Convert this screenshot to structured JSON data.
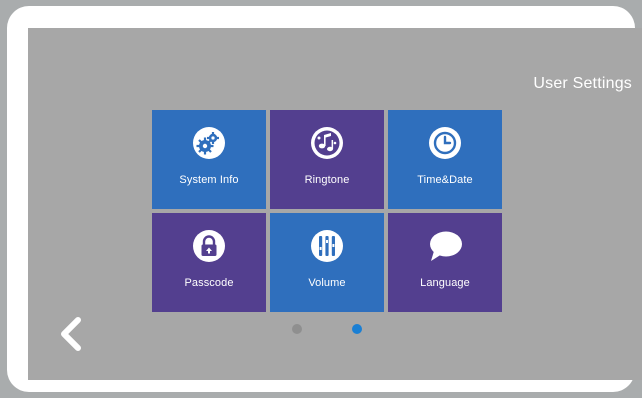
{
  "screen": {
    "title": "User Settings"
  },
  "tiles": [
    {
      "label": "System Info",
      "icon": "gears-icon",
      "color": "#2f6fbd"
    },
    {
      "label": "Ringtone",
      "icon": "music-notes-icon",
      "color": "#533f8f"
    },
    {
      "label": "Time&Date",
      "icon": "clock-icon",
      "color": "#2f6fbd"
    },
    {
      "label": "Passcode",
      "icon": "lock-icon",
      "color": "#533f8f"
    },
    {
      "label": "Volume",
      "icon": "equalizer-icon",
      "color": "#2f6fbd"
    },
    {
      "label": "Language",
      "icon": "speech-bubble-icon",
      "color": "#533f8f"
    }
  ],
  "pagination": {
    "pages": 2,
    "active_page": 2,
    "inactive_color": "#8f8f8f",
    "active_color": "#1a7fd4"
  },
  "navigation": {
    "back_icon": "chevron-left-icon"
  }
}
